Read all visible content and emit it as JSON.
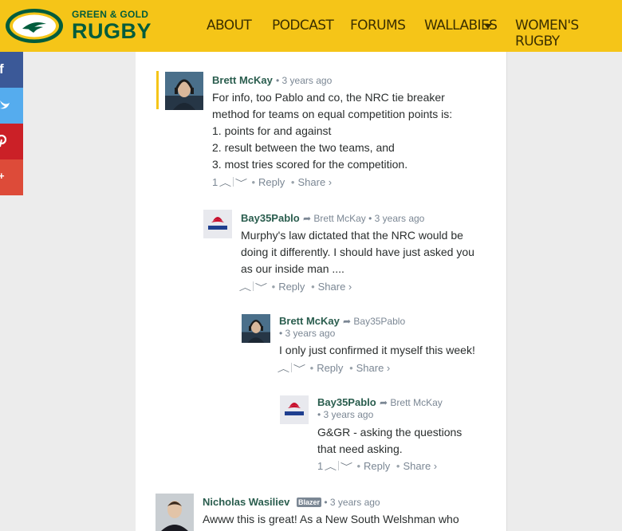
{
  "header": {
    "logo_top": "GREEN & GOLD",
    "logo_bottom": "RUGBY",
    "nav": [
      "ABOUT",
      "PODCAST",
      "FORUMS",
      "WALLABIES",
      "WOMEN'S RUGBY"
    ]
  },
  "social": [
    "f",
    "twitter",
    "pinterest",
    "g+"
  ],
  "comments": [
    {
      "author": "Brett McKay",
      "time": "3 years ago",
      "lines": [
        "For info, too Pablo and co, the NRC tie breaker",
        "method for teams on equal competition points is:",
        "1. points for and against",
        "2. result between the two teams, and",
        "3. most tries scored for the competition."
      ],
      "votes": "1",
      "reply": "Reply",
      "share": "Share ›"
    },
    {
      "author": "Bay35Pablo",
      "reply_to": "Brett McKay",
      "time": "3 years ago",
      "lines": [
        "Murphy's law dictated that the NRC would be",
        "doing it differently. I should have just asked you",
        "as our inside man ...."
      ],
      "votes": "",
      "reply": "Reply",
      "share": "Share ›"
    },
    {
      "author": "Brett McKay",
      "reply_to": "Bay35Pablo",
      "time": "3 years ago",
      "lines": [
        "I only just confirmed it myself this week!"
      ],
      "votes": "",
      "reply": "Reply",
      "share": "Share ›"
    },
    {
      "author": "Bay35Pablo",
      "reply_to": "Brett McKay",
      "time": "3 years ago",
      "lines": [
        "G&GR - asking the questions",
        "that need asking."
      ],
      "votes": "1",
      "reply": "Reply",
      "share": "Share ›"
    },
    {
      "author": "Nicholas Wasiliev",
      "badge": "Blazer",
      "time": "3 years ago",
      "lines": [
        "Awww this is great! As a New South Welshman who"
      ]
    }
  ],
  "colors": {
    "header": "#f5c518",
    "brand_green": "#005c3c",
    "facebook": "#3b5998",
    "twitter": "#55acee",
    "pinterest": "#cb2027",
    "googleplus": "#dd4b39"
  }
}
